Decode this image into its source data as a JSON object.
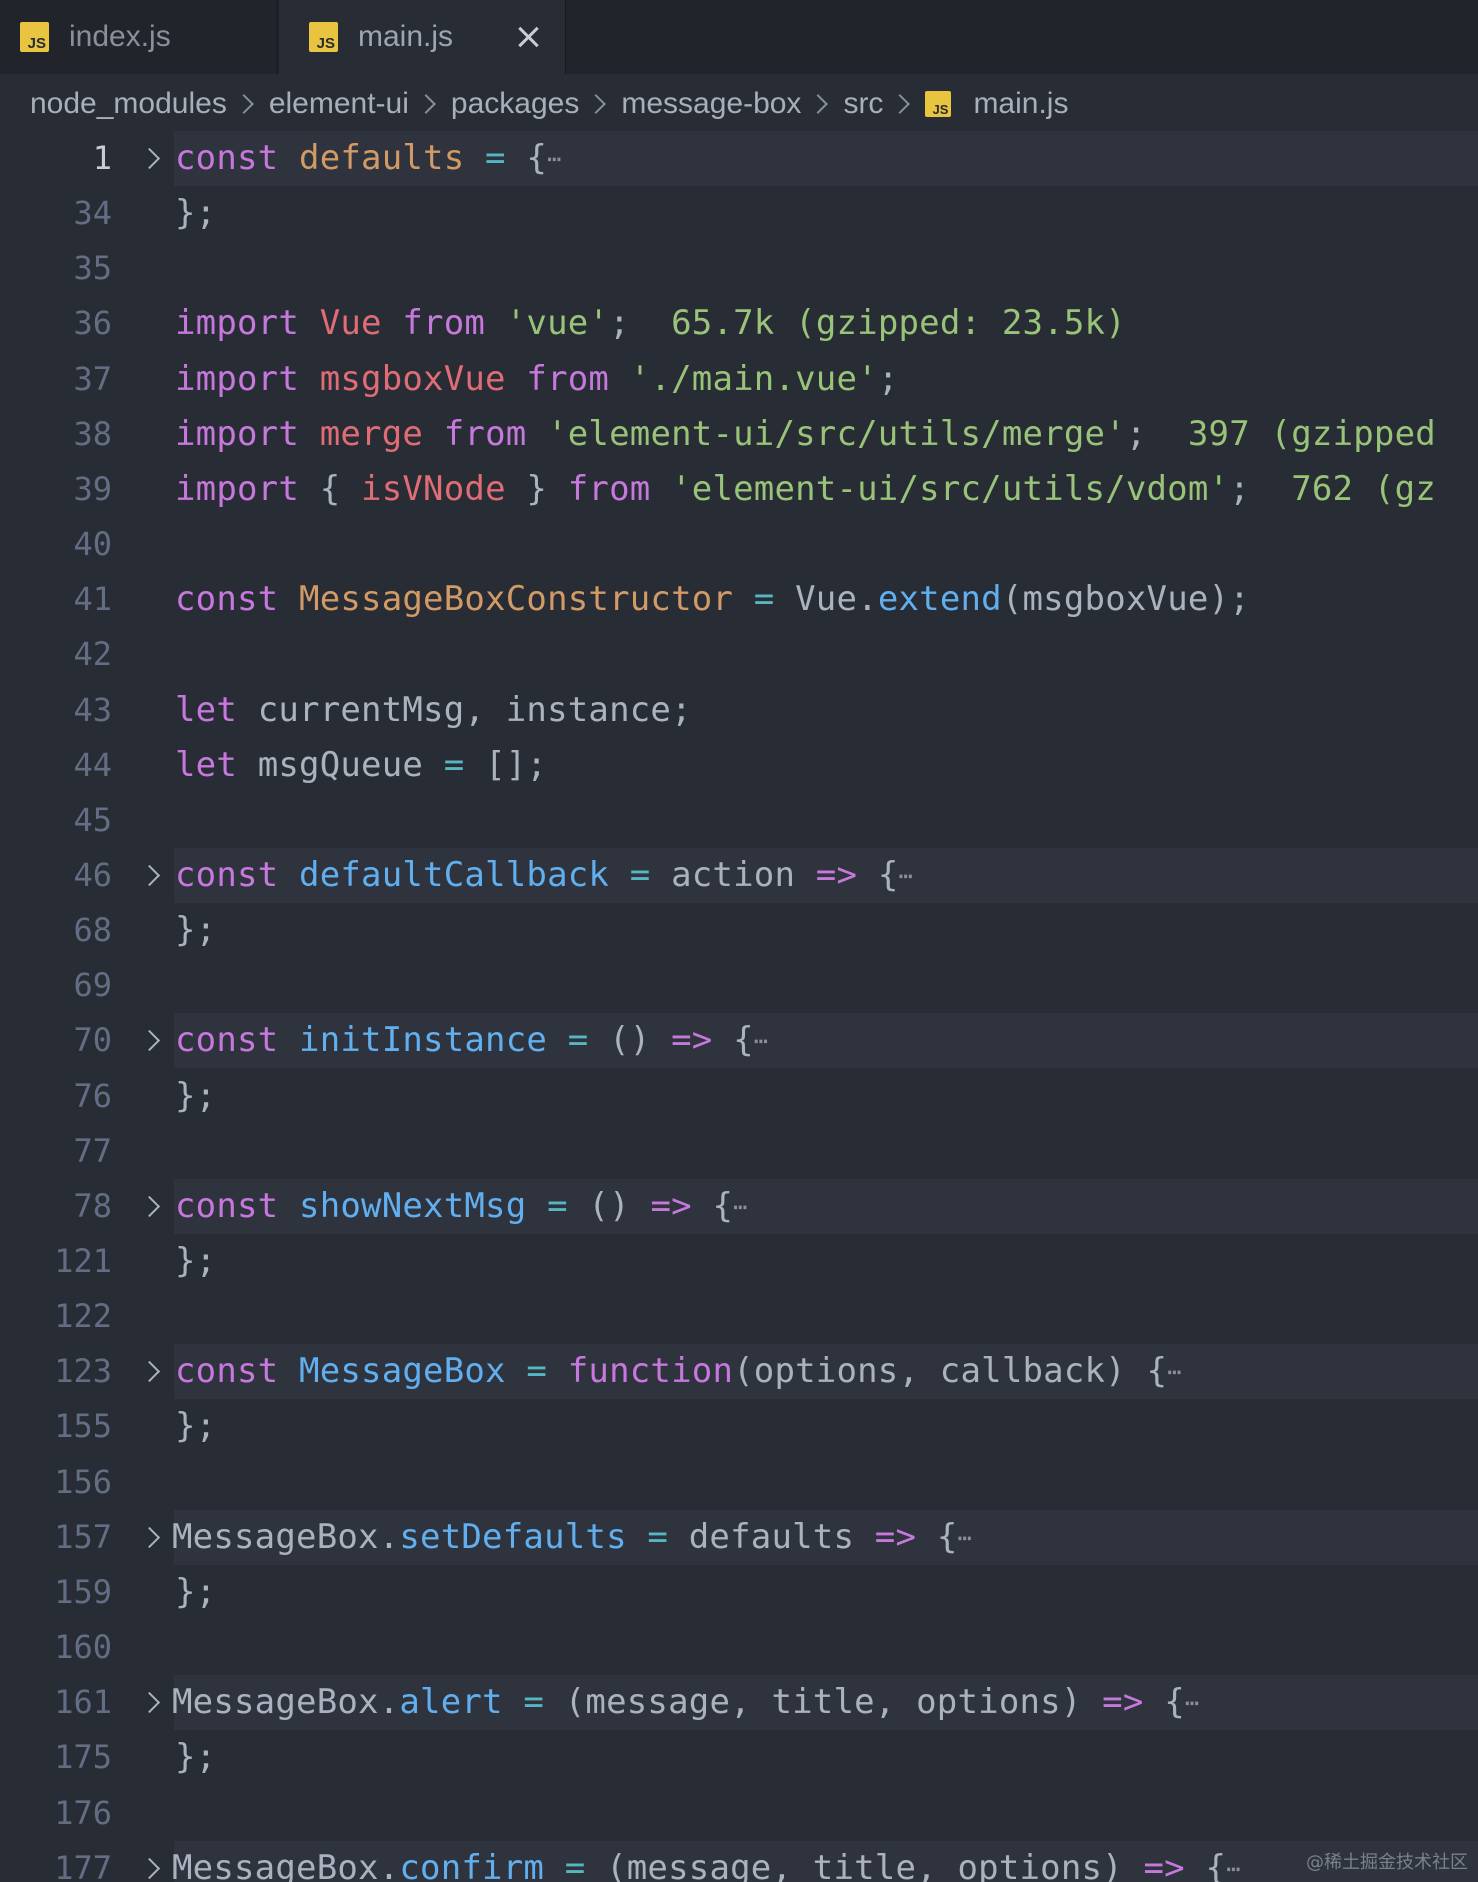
{
  "tabs": [
    {
      "label": "index.js",
      "icon": "js-file-icon"
    },
    {
      "label": "main.js",
      "icon": "js-file-icon",
      "active": true
    }
  ],
  "breadcrumb": [
    "node_modules",
    "element-ui",
    "packages",
    "message-box",
    "src",
    "main.js"
  ],
  "icon_text": "JS",
  "editor": {
    "lines": [
      {
        "num": "1",
        "fold": true,
        "active": true,
        "tokens": [
          [
            "k",
            "const "
          ],
          [
            "vo",
            "defaults"
          ],
          [
            "o",
            " = "
          ],
          [
            "p",
            "{"
          ],
          [
            "dots",
            "⋯"
          ]
        ]
      },
      {
        "num": "34",
        "tokens": [
          [
            "p",
            "};"
          ]
        ]
      },
      {
        "num": "35",
        "tokens": []
      },
      {
        "num": "36",
        "tokens": [
          [
            "k",
            "import "
          ],
          [
            "r",
            "Vue "
          ],
          [
            "k",
            "from "
          ],
          [
            "s",
            "'vue'"
          ],
          [
            "p",
            ";  "
          ],
          [
            "hint",
            "65.7k (gzipped: 23.5k)"
          ]
        ]
      },
      {
        "num": "37",
        "tokens": [
          [
            "k",
            "import "
          ],
          [
            "r",
            "msgboxVue "
          ],
          [
            "k",
            "from "
          ],
          [
            "s",
            "'./main.vue'"
          ],
          [
            "p",
            ";"
          ]
        ]
      },
      {
        "num": "38",
        "tokens": [
          [
            "k",
            "import "
          ],
          [
            "r",
            "merge "
          ],
          [
            "k",
            "from "
          ],
          [
            "s",
            "'element-ui/src/utils/merge'"
          ],
          [
            "p",
            ";  "
          ],
          [
            "hint",
            "397 (gzipped"
          ]
        ]
      },
      {
        "num": "39",
        "tokens": [
          [
            "k",
            "import "
          ],
          [
            "p",
            "{ "
          ],
          [
            "r",
            "isVNode "
          ],
          [
            "p",
            "} "
          ],
          [
            "k",
            "from "
          ],
          [
            "s",
            "'element-ui/src/utils/vdom'"
          ],
          [
            "p",
            ";  "
          ],
          [
            "hint",
            "762 (gz"
          ]
        ]
      },
      {
        "num": "40",
        "tokens": []
      },
      {
        "num": "41",
        "tokens": [
          [
            "k",
            "const "
          ],
          [
            "vo",
            "MessageBoxConstructor"
          ],
          [
            "o",
            " = "
          ],
          [
            "p",
            "Vue."
          ],
          [
            "f",
            "extend"
          ],
          [
            "p",
            "(msgboxVue);"
          ]
        ]
      },
      {
        "num": "42",
        "tokens": []
      },
      {
        "num": "43",
        "tokens": [
          [
            "k",
            "let "
          ],
          [
            "p",
            "currentMsg, instance;"
          ]
        ]
      },
      {
        "num": "44",
        "tokens": [
          [
            "k",
            "let "
          ],
          [
            "p",
            "msgQueue "
          ],
          [
            "o",
            "= "
          ],
          [
            "p",
            "[];"
          ]
        ]
      },
      {
        "num": "45",
        "tokens": []
      },
      {
        "num": "46",
        "fold": true,
        "tokens": [
          [
            "k",
            "const "
          ],
          [
            "f",
            "defaultCallback"
          ],
          [
            "o",
            " = "
          ],
          [
            "p",
            "action "
          ],
          [
            "k",
            "=> "
          ],
          [
            "p",
            "{"
          ],
          [
            "dots",
            "⋯"
          ]
        ]
      },
      {
        "num": "68",
        "tokens": [
          [
            "p",
            "};"
          ]
        ]
      },
      {
        "num": "69",
        "tokens": []
      },
      {
        "num": "70",
        "fold": true,
        "tokens": [
          [
            "k",
            "const "
          ],
          [
            "f",
            "initInstance"
          ],
          [
            "o",
            " = "
          ],
          [
            "p",
            "() "
          ],
          [
            "k",
            "=> "
          ],
          [
            "p",
            "{"
          ],
          [
            "dots",
            "⋯"
          ]
        ]
      },
      {
        "num": "76",
        "tokens": [
          [
            "p",
            "};"
          ]
        ]
      },
      {
        "num": "77",
        "tokens": []
      },
      {
        "num": "78",
        "fold": true,
        "tokens": [
          [
            "k",
            "const "
          ],
          [
            "f",
            "showNextMsg"
          ],
          [
            "o",
            " = "
          ],
          [
            "p",
            "() "
          ],
          [
            "k",
            "=> "
          ],
          [
            "p",
            "{"
          ],
          [
            "dots",
            "⋯"
          ]
        ]
      },
      {
        "num": "121",
        "tokens": [
          [
            "p",
            "};"
          ]
        ]
      },
      {
        "num": "122",
        "tokens": []
      },
      {
        "num": "123",
        "fold": true,
        "tokens": [
          [
            "k",
            "const "
          ],
          [
            "f",
            "MessageBox"
          ],
          [
            "o",
            " = "
          ],
          [
            "k",
            "function"
          ],
          [
            "p",
            "(options, callback) {"
          ],
          [
            "dots",
            "⋯"
          ]
        ]
      },
      {
        "num": "155",
        "tokens": [
          [
            "p",
            "};"
          ]
        ]
      },
      {
        "num": "156",
        "tokens": []
      },
      {
        "num": "157",
        "fold": true,
        "shift": true,
        "tokens": [
          [
            "p",
            "MessageBox."
          ],
          [
            "f",
            "setDefaults"
          ],
          [
            "o",
            " = "
          ],
          [
            "p",
            "defaults "
          ],
          [
            "k",
            "=> "
          ],
          [
            "p",
            "{"
          ],
          [
            "dots",
            "⋯"
          ]
        ]
      },
      {
        "num": "159",
        "tokens": [
          [
            "p",
            "};"
          ]
        ]
      },
      {
        "num": "160",
        "tokens": []
      },
      {
        "num": "161",
        "fold": true,
        "shift": true,
        "tokens": [
          [
            "p",
            "MessageBox."
          ],
          [
            "f",
            "alert"
          ],
          [
            "o",
            " = "
          ],
          [
            "p",
            "(message, title, options) "
          ],
          [
            "k",
            "=> "
          ],
          [
            "p",
            "{"
          ],
          [
            "dots",
            "⋯"
          ]
        ]
      },
      {
        "num": "175",
        "tokens": [
          [
            "p",
            "};"
          ]
        ]
      },
      {
        "num": "176",
        "tokens": []
      },
      {
        "num": "177",
        "fold": true,
        "shift": true,
        "tokens": [
          [
            "p",
            "MessageBox."
          ],
          [
            "f",
            "confirm"
          ],
          [
            "o",
            " = "
          ],
          [
            "p",
            "(message, title, options) "
          ],
          [
            "k",
            "=> "
          ],
          [
            "p",
            "{"
          ],
          [
            "dots",
            "⋯"
          ]
        ]
      }
    ]
  },
  "watermark": "@稀土掘金技术社区",
  "colors": {
    "background": "#282c34",
    "keyword": "#c678dd",
    "string": "#98c379",
    "function": "#61afef",
    "variable": "#e06c75",
    "constant": "#d19a66",
    "operator": "#56b6c2"
  }
}
